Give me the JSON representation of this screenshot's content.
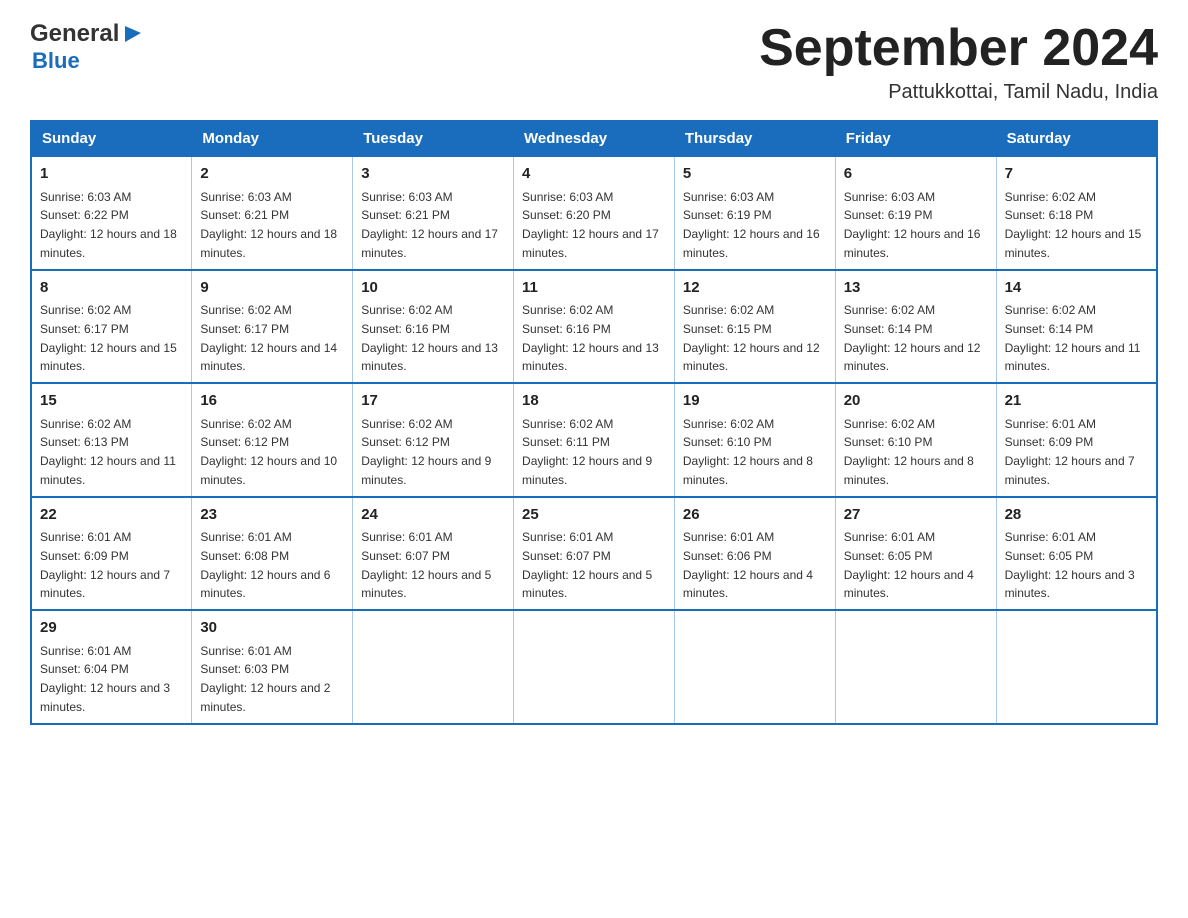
{
  "logo": {
    "line1": "General",
    "arrow": "▶",
    "line2": "Blue"
  },
  "title": "September 2024",
  "subtitle": "Pattukkottai, Tamil Nadu, India",
  "weekdays": [
    "Sunday",
    "Monday",
    "Tuesday",
    "Wednesday",
    "Thursday",
    "Friday",
    "Saturday"
  ],
  "weeks": [
    [
      {
        "day": "1",
        "sunrise": "6:03 AM",
        "sunset": "6:22 PM",
        "daylight": "12 hours and 18 minutes."
      },
      {
        "day": "2",
        "sunrise": "6:03 AM",
        "sunset": "6:21 PM",
        "daylight": "12 hours and 18 minutes."
      },
      {
        "day": "3",
        "sunrise": "6:03 AM",
        "sunset": "6:21 PM",
        "daylight": "12 hours and 17 minutes."
      },
      {
        "day": "4",
        "sunrise": "6:03 AM",
        "sunset": "6:20 PM",
        "daylight": "12 hours and 17 minutes."
      },
      {
        "day": "5",
        "sunrise": "6:03 AM",
        "sunset": "6:19 PM",
        "daylight": "12 hours and 16 minutes."
      },
      {
        "day": "6",
        "sunrise": "6:03 AM",
        "sunset": "6:19 PM",
        "daylight": "12 hours and 16 minutes."
      },
      {
        "day": "7",
        "sunrise": "6:02 AM",
        "sunset": "6:18 PM",
        "daylight": "12 hours and 15 minutes."
      }
    ],
    [
      {
        "day": "8",
        "sunrise": "6:02 AM",
        "sunset": "6:17 PM",
        "daylight": "12 hours and 15 minutes."
      },
      {
        "day": "9",
        "sunrise": "6:02 AM",
        "sunset": "6:17 PM",
        "daylight": "12 hours and 14 minutes."
      },
      {
        "day": "10",
        "sunrise": "6:02 AM",
        "sunset": "6:16 PM",
        "daylight": "12 hours and 13 minutes."
      },
      {
        "day": "11",
        "sunrise": "6:02 AM",
        "sunset": "6:16 PM",
        "daylight": "12 hours and 13 minutes."
      },
      {
        "day": "12",
        "sunrise": "6:02 AM",
        "sunset": "6:15 PM",
        "daylight": "12 hours and 12 minutes."
      },
      {
        "day": "13",
        "sunrise": "6:02 AM",
        "sunset": "6:14 PM",
        "daylight": "12 hours and 12 minutes."
      },
      {
        "day": "14",
        "sunrise": "6:02 AM",
        "sunset": "6:14 PM",
        "daylight": "12 hours and 11 minutes."
      }
    ],
    [
      {
        "day": "15",
        "sunrise": "6:02 AM",
        "sunset": "6:13 PM",
        "daylight": "12 hours and 11 minutes."
      },
      {
        "day": "16",
        "sunrise": "6:02 AM",
        "sunset": "6:12 PM",
        "daylight": "12 hours and 10 minutes."
      },
      {
        "day": "17",
        "sunrise": "6:02 AM",
        "sunset": "6:12 PM",
        "daylight": "12 hours and 9 minutes."
      },
      {
        "day": "18",
        "sunrise": "6:02 AM",
        "sunset": "6:11 PM",
        "daylight": "12 hours and 9 minutes."
      },
      {
        "day": "19",
        "sunrise": "6:02 AM",
        "sunset": "6:10 PM",
        "daylight": "12 hours and 8 minutes."
      },
      {
        "day": "20",
        "sunrise": "6:02 AM",
        "sunset": "6:10 PM",
        "daylight": "12 hours and 8 minutes."
      },
      {
        "day": "21",
        "sunrise": "6:01 AM",
        "sunset": "6:09 PM",
        "daylight": "12 hours and 7 minutes."
      }
    ],
    [
      {
        "day": "22",
        "sunrise": "6:01 AM",
        "sunset": "6:09 PM",
        "daylight": "12 hours and 7 minutes."
      },
      {
        "day": "23",
        "sunrise": "6:01 AM",
        "sunset": "6:08 PM",
        "daylight": "12 hours and 6 minutes."
      },
      {
        "day": "24",
        "sunrise": "6:01 AM",
        "sunset": "6:07 PM",
        "daylight": "12 hours and 5 minutes."
      },
      {
        "day": "25",
        "sunrise": "6:01 AM",
        "sunset": "6:07 PM",
        "daylight": "12 hours and 5 minutes."
      },
      {
        "day": "26",
        "sunrise": "6:01 AM",
        "sunset": "6:06 PM",
        "daylight": "12 hours and 4 minutes."
      },
      {
        "day": "27",
        "sunrise": "6:01 AM",
        "sunset": "6:05 PM",
        "daylight": "12 hours and 4 minutes."
      },
      {
        "day": "28",
        "sunrise": "6:01 AM",
        "sunset": "6:05 PM",
        "daylight": "12 hours and 3 minutes."
      }
    ],
    [
      {
        "day": "29",
        "sunrise": "6:01 AM",
        "sunset": "6:04 PM",
        "daylight": "12 hours and 3 minutes."
      },
      {
        "day": "30",
        "sunrise": "6:01 AM",
        "sunset": "6:03 PM",
        "daylight": "12 hours and 2 minutes."
      },
      null,
      null,
      null,
      null,
      null
    ]
  ]
}
